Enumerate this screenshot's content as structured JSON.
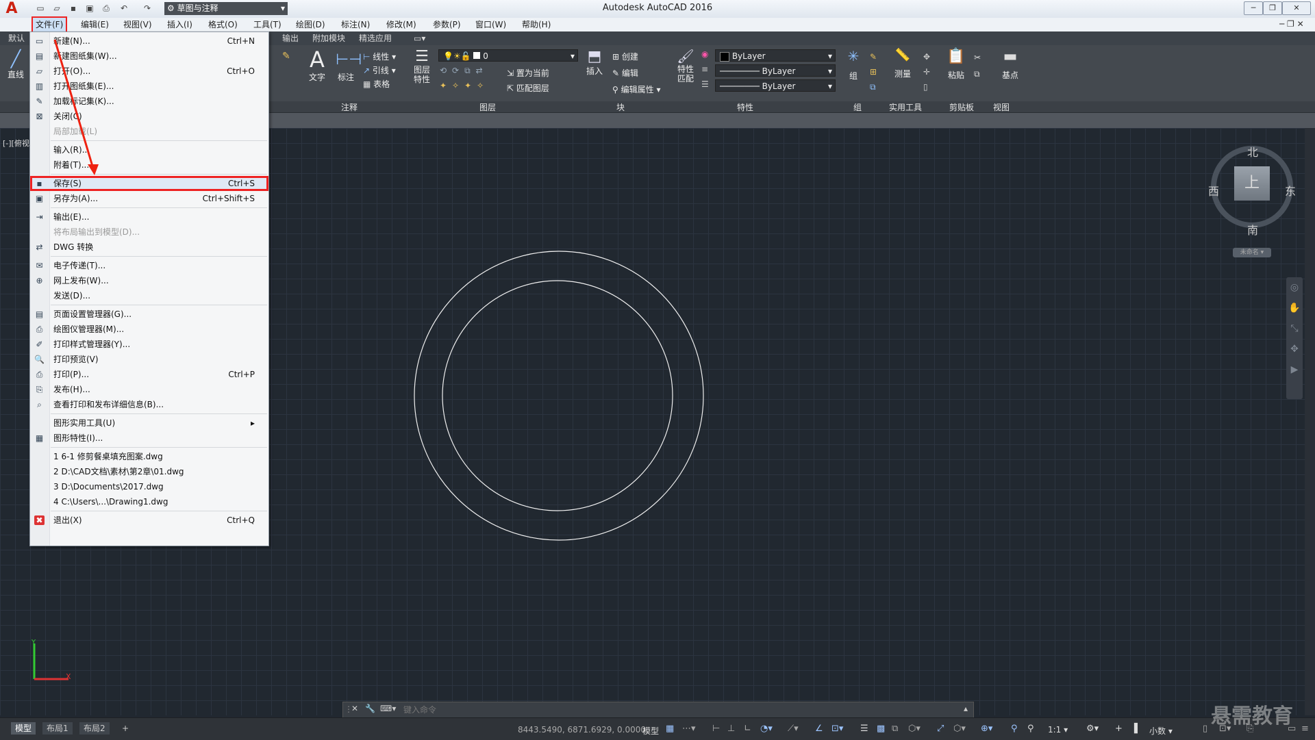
{
  "window": {
    "title": "Autodesk AutoCAD 2016",
    "workspace": "草图与注释"
  },
  "menubar": [
    "文件(F)",
    "编辑(E)",
    "视图(V)",
    "插入(I)",
    "格式(O)",
    "工具(T)",
    "绘图(D)",
    "标注(N)",
    "修改(M)",
    "参数(P)",
    "窗口(W)",
    "帮助(H)"
  ],
  "ribbon_tabs": [
    "默认",
    "输出",
    "附加模块",
    "精选应用"
  ],
  "ribbon": {
    "draw_btn": "直线",
    "text_btn": "文字",
    "dim_btn": "标注",
    "linear": "线性",
    "leader": "引线",
    "table": "表格",
    "annotate_panel": "注释",
    "layer_props": "图层\n特性",
    "layer_combo": "0",
    "set_current": "置为当前",
    "match_layer": "匹配图层",
    "layer_panel": "图层",
    "insert_btn": "插入",
    "create": "创建",
    "edit": "编辑",
    "edit_attr": "编辑属性",
    "block_panel": "块",
    "match_props": "特性\n匹配",
    "bylayer1": "ByLayer",
    "bylayer2": "ByLayer",
    "bylayer3": "ByLayer",
    "props_panel": "特性",
    "group_btn": "组",
    "group_panel": "组",
    "measure_btn": "测量",
    "utility_panel": "实用工具",
    "paste_btn": "粘贴",
    "clipboard_panel": "剪贴板",
    "base_btn": "基点",
    "view_panel": "视图"
  },
  "file_menu": {
    "items": [
      {
        "label": "新建(N)...",
        "shortcut": "Ctrl+N",
        "icon": "new-icon"
      },
      {
        "label": "新建图纸集(W)...",
        "shortcut": "",
        "icon": "sheetset-icon"
      },
      {
        "label": "打开(O)...",
        "shortcut": "Ctrl+O",
        "icon": "open-icon"
      },
      {
        "label": "打开图纸集(E)...",
        "shortcut": "",
        "icon": "open-sheetset-icon"
      },
      {
        "label": "加载标记集(K)...",
        "shortcut": "",
        "icon": "markup-icon"
      },
      {
        "label": "关闭(C)",
        "shortcut": "",
        "icon": "close-file-icon"
      },
      {
        "label": "局部加载(L)",
        "shortcut": "",
        "icon": "",
        "disabled": true
      },
      {
        "label": "输入(R)...",
        "shortcut": "",
        "icon": ""
      },
      {
        "label": "附着(T)...",
        "shortcut": "",
        "icon": ""
      },
      {
        "label": "保存(S)",
        "shortcut": "Ctrl+S",
        "icon": "save-icon",
        "highlight": true
      },
      {
        "label": "另存为(A)...",
        "shortcut": "Ctrl+Shift+S",
        "icon": "saveas-icon"
      },
      {
        "label": "输出(E)...",
        "shortcut": "",
        "icon": "export-icon"
      },
      {
        "label": "将布局输出到模型(D)...",
        "shortcut": "",
        "icon": "",
        "disabled": true
      },
      {
        "label": "DWG 转换",
        "shortcut": "",
        "icon": "dwg-convert-icon"
      },
      {
        "label": "电子传递(T)...",
        "shortcut": "",
        "icon": "etransmit-icon"
      },
      {
        "label": "网上发布(W)...",
        "shortcut": "",
        "icon": "web-publish-icon"
      },
      {
        "label": "发送(D)...",
        "shortcut": "",
        "icon": ""
      },
      {
        "label": "页面设置管理器(G)...",
        "shortcut": "",
        "icon": "page-setup-icon"
      },
      {
        "label": "绘图仪管理器(M)...",
        "shortcut": "",
        "icon": "plotter-icon"
      },
      {
        "label": "打印样式管理器(Y)...",
        "shortcut": "",
        "icon": "plot-style-icon"
      },
      {
        "label": "打印预览(V)",
        "shortcut": "",
        "icon": "preview-icon"
      },
      {
        "label": "打印(P)...",
        "shortcut": "Ctrl+P",
        "icon": "print-icon"
      },
      {
        "label": "发布(H)...",
        "shortcut": "",
        "icon": "publish-icon"
      },
      {
        "label": "查看打印和发布详细信息(B)...",
        "shortcut": "",
        "icon": "details-icon"
      },
      {
        "label": "图形实用工具(U)",
        "shortcut": "",
        "icon": "",
        "submenu": true
      },
      {
        "label": "图形特性(I)...",
        "shortcut": "",
        "icon": "drawing-props-icon"
      },
      {
        "label": "1 6-1 修剪餐桌填充图案.dwg",
        "shortcut": "",
        "icon": ""
      },
      {
        "label": "2 D:\\CAD文档\\素材\\第2章\\01.dwg",
        "shortcut": "",
        "icon": ""
      },
      {
        "label": "3 D:\\Documents\\2017.dwg",
        "shortcut": "",
        "icon": ""
      },
      {
        "label": "4 C:\\Users\\...\\Drawing1.dwg",
        "shortcut": "",
        "icon": ""
      },
      {
        "label": "退出(X)",
        "shortcut": "Ctrl+Q",
        "icon": "exit-icon"
      }
    ]
  },
  "viewport_label": "[-][俯视]",
  "viewcube": {
    "north": "北",
    "south": "南",
    "east": "东",
    "west": "西",
    "top": "上",
    "wcs": "未命名"
  },
  "command": {
    "placeholder": "键入命令"
  },
  "layout_tabs": [
    "模型",
    "布局1",
    "布局2"
  ],
  "status": {
    "coords": "8443.5490, 6871.6929, 0.0000",
    "model": "模型",
    "scale": "1:1",
    "units": "小数"
  },
  "watermark": "悬需教育"
}
